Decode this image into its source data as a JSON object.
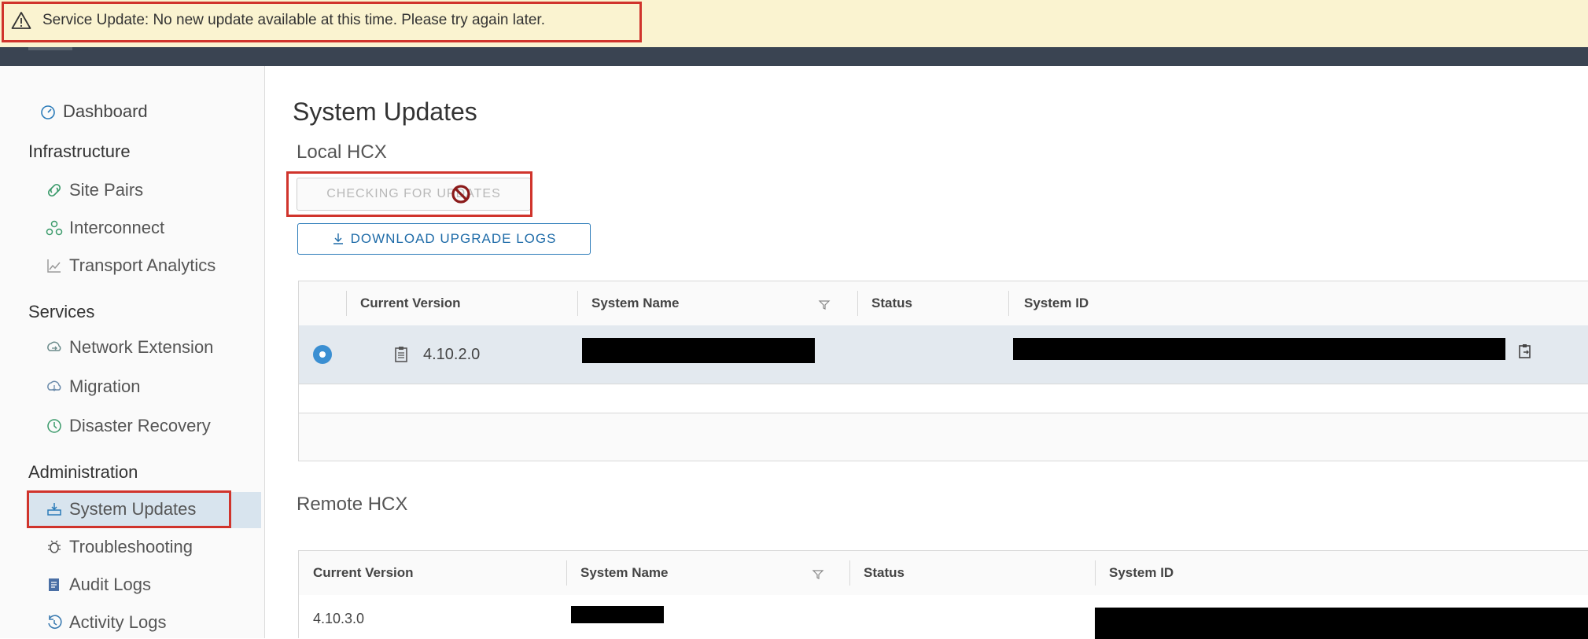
{
  "banner": {
    "message": "Service Update: No new update available at this time. Please try again later.",
    "icon": "warning-icon"
  },
  "sidebar": {
    "dashboard": "Dashboard",
    "infrastructure_heading": "Infrastructure",
    "site_pairs": "Site Pairs",
    "interconnect": "Interconnect",
    "transport_analytics": "Transport Analytics",
    "services_heading": "Services",
    "network_extension": "Network Extension",
    "migration": "Migration",
    "disaster_recovery": "Disaster Recovery",
    "administration_heading": "Administration",
    "system_updates": "System Updates",
    "troubleshooting": "Troubleshooting",
    "audit_logs": "Audit Logs",
    "activity_logs": "Activity Logs"
  },
  "main": {
    "title": "System Updates",
    "local_section": "Local HCX",
    "check_button": "CHECKING FOR UPDATES",
    "download_button": "DOWNLOAD UPGRADE LOGS",
    "remote_section": "Remote HCX"
  },
  "local_grid": {
    "columns": [
      "Current Version",
      "System Name",
      "Status",
      "System ID"
    ],
    "rows": [
      {
        "current_version": "4.10.2.0",
        "system_name": "",
        "status": "",
        "system_id": ""
      }
    ]
  },
  "remote_grid": {
    "columns": [
      "Current Version",
      "System Name",
      "Status",
      "System ID"
    ],
    "rows": [
      {
        "current_version": "4.10.3.0",
        "system_name": "",
        "status": "",
        "system_id": ""
      }
    ]
  },
  "colors": {
    "banner_bg": "#faf3d0",
    "header_bar": "#3a4452",
    "highlight_border": "#d0342c",
    "accent": "#1e6ba8",
    "selected_row": "#e3e9ef"
  }
}
